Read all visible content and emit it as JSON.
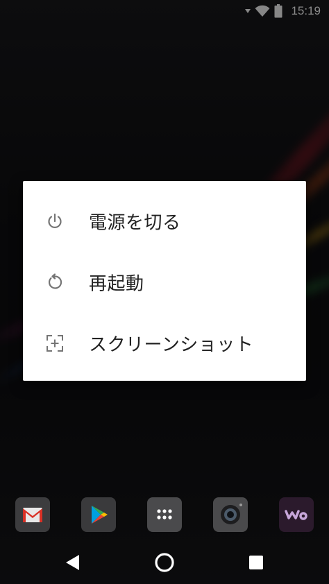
{
  "status_bar": {
    "time": "15:19",
    "icons": [
      "signal-arrow-icon",
      "wifi-icon",
      "battery-icon"
    ]
  },
  "power_menu": {
    "items": [
      {
        "label": "電源を切る",
        "icon": "power-icon"
      },
      {
        "label": "再起動",
        "icon": "restart-icon"
      },
      {
        "label": "スクリーンショット",
        "icon": "screenshot-icon"
      }
    ]
  },
  "dock": {
    "apps": [
      {
        "name": "gmail-icon",
        "accent": "#d93025"
      },
      {
        "name": "play-store-icon",
        "accent": "#34a853"
      },
      {
        "name": "app-drawer-icon",
        "accent": "#ffffff"
      },
      {
        "name": "camera-icon",
        "accent": "#222222"
      },
      {
        "name": "walkman-icon",
        "accent": "#c7a6d9"
      }
    ]
  },
  "nav_bar": {
    "buttons": [
      "back-icon",
      "home-icon",
      "recents-icon"
    ]
  },
  "colors": {
    "menu_background": "#ffffff",
    "menu_text": "#222222",
    "menu_icon": "#757575"
  }
}
